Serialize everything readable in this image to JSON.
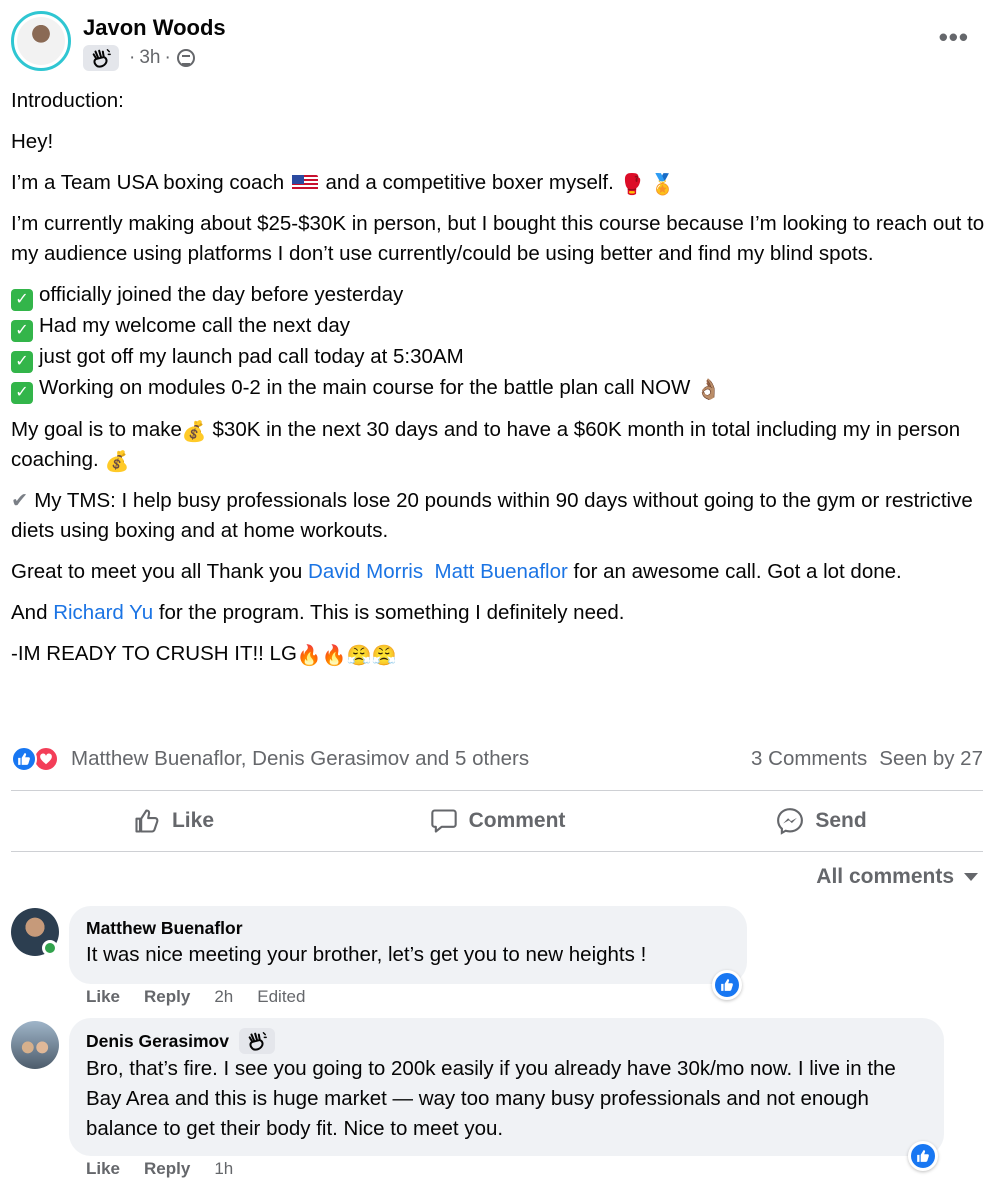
{
  "post": {
    "author": "Javon Woods",
    "time": "3h",
    "meta_dot": "·",
    "more": "•••",
    "paragraphs": {
      "intro": "Introduction:",
      "hey": "Hey!",
      "coach_a": "I’m a Team USA boxing coach",
      "coach_b": "and a competitive boxer myself.",
      "current": "I’m currently making about $25-$30K in person, but I bought this course because I’m looking to reach out to my audience using platforms I don’t use currently/could be using better and find my blind spots.",
      "checks": [
        "officially joined the day before yesterday",
        "Had my welcome call the next day",
        "just got off my launch pad call today at 5:30AM",
        "Working on modules 0-2 in the main course for the battle plan call NOW"
      ],
      "goal_a": "My goal is to make",
      "goal_b": "$30K in the next 30 days and to have a $60K month in total including my in person coaching.",
      "tms": "My TMS: I help busy professionals lose 20 pounds within 90 days without going to the gym or restrictive diets using boxing and at home workouts.",
      "thanks_a": "Great to meet you all Thank you",
      "thanks_link1": "David Morris",
      "thanks_link2": "Matt Buenaflor",
      "thanks_b": "for an awesome call. Got a lot done.",
      "and_a": "And",
      "and_link": "Richard Yu",
      "and_b": "for the program. This is something I definitely need.",
      "ready": "-IM READY TO CRUSH IT!! LG"
    },
    "emoji": {
      "glove": "🥊",
      "medal": "🏅",
      "ok_hand": "👌🏽",
      "money_bag": "💰",
      "fire": "🔥",
      "steam": "😤",
      "check_mark": "✔"
    }
  },
  "reactions": {
    "names": "Matthew Buenaflor, Denis Gerasimov and 5 others",
    "comments": "3 Comments",
    "seen": "Seen by 27"
  },
  "actions": {
    "like": "Like",
    "comment": "Comment",
    "send": "Send"
  },
  "comments_filter": "All comments",
  "comments": [
    {
      "author": "Matthew Buenaflor",
      "text": "It was nice meeting your brother, let’s get you to new heights  !",
      "like": "Like",
      "reply": "Reply",
      "time": "2h",
      "edited": "Edited"
    },
    {
      "author": "Denis Gerasimov",
      "text": "Bro, that’s fire. I see you going to 200k easily if you already have 30k/mo now. I live in the Bay Area and this is huge market — way too many busy professionals and not enough balance to get their body fit. Nice to meet you.",
      "like": "Like",
      "reply": "Reply",
      "time": "1h"
    }
  ],
  "colors": {
    "accent": "#1877f2",
    "link": "#1b74e4",
    "muted": "#65676b",
    "bubble": "#f0f2f5",
    "love": "#f33e58",
    "avatar_ring": "#2fc6d2"
  }
}
